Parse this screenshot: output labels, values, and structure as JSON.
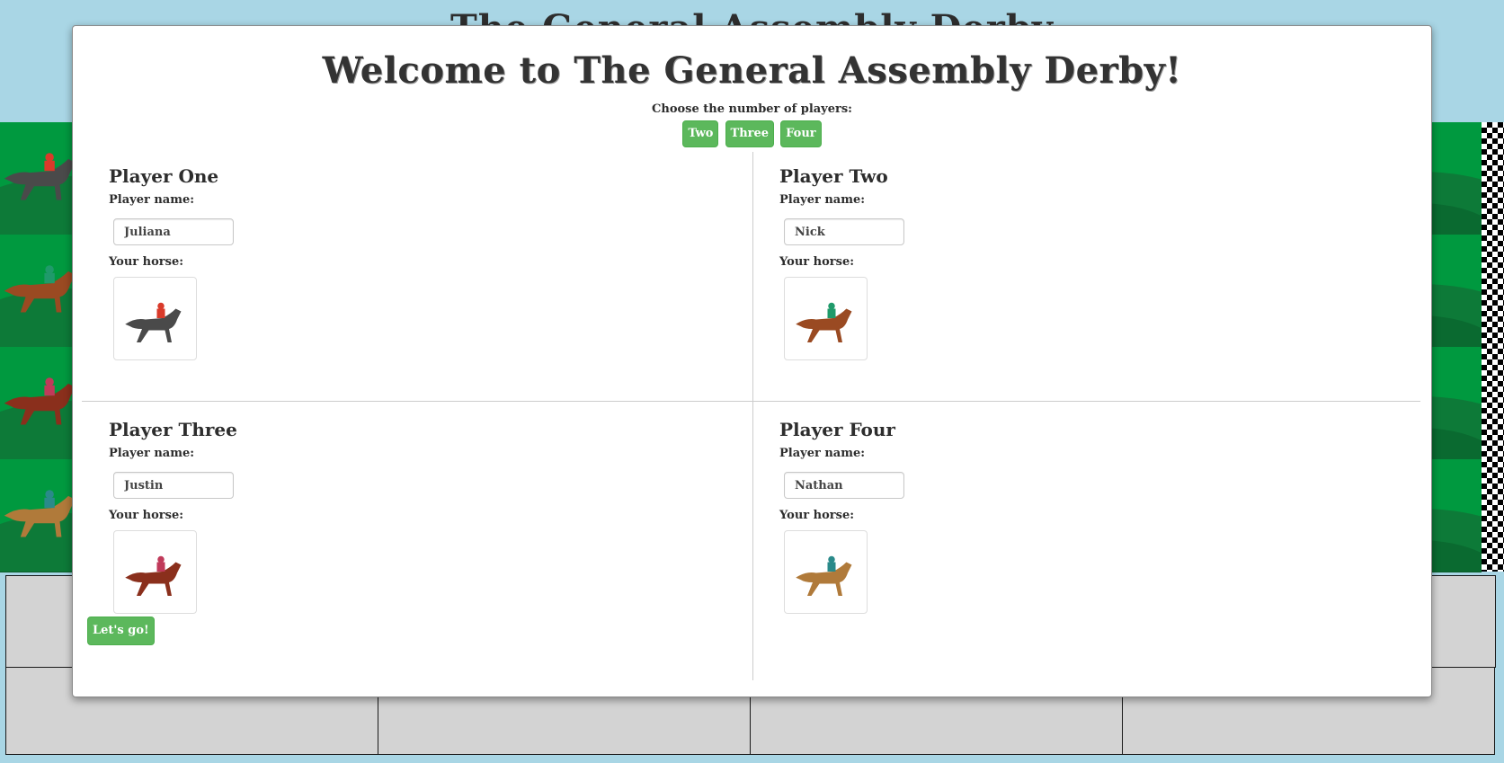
{
  "background": {
    "title": " The General Assembly Derby "
  },
  "modal": {
    "title": "Welcome to The General Assembly Derby!",
    "choose_label": "Choose the number of players:",
    "count_buttons": [
      "Two",
      "Three",
      "Four"
    ],
    "go_button": "Let's go!"
  },
  "players": [
    {
      "heading": "Player One",
      "name_label": "Player name:",
      "name_value": "Juliana",
      "horse_label": "Your horse:",
      "horse": "gray-horse-icon",
      "body_color": "#4a4a4a",
      "silk_color": "#d93a2a",
      "number": "4"
    },
    {
      "heading": "Player Two",
      "name_label": "Player name:",
      "name_value": "Nick",
      "horse_label": "Your horse:",
      "horse": "chestnut-horse-icon",
      "body_color": "#9a4a22",
      "silk_color": "#1f9a6a",
      "number": "3"
    },
    {
      "heading": "Player Three",
      "name_label": "Player name:",
      "name_value": "Justin",
      "horse_label": "Your horse:",
      "horse": "bay-horse-icon",
      "body_color": "#8a2f1c",
      "silk_color": "#c03a5a",
      "number": "8"
    },
    {
      "heading": "Player Four",
      "name_label": "Player name:",
      "name_value": "Nathan",
      "horse_label": "Your horse:",
      "horse": "palomino-horse-icon",
      "body_color": "#b07a3a",
      "silk_color": "#2a8a8a",
      "number": "6"
    }
  ],
  "colors": {
    "sky": "#a9d6e5",
    "track": "#00993f",
    "button": "#5cb85c",
    "panel": "#d3d3d3"
  }
}
